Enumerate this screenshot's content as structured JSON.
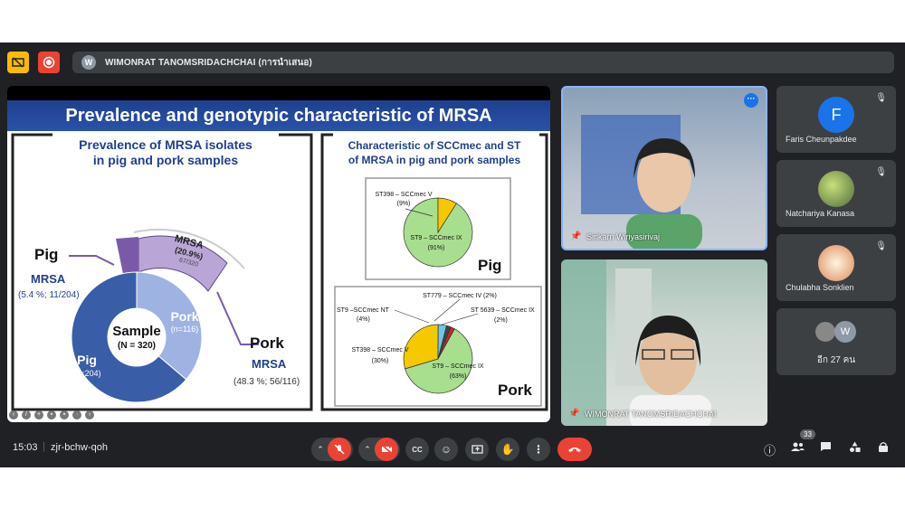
{
  "topbar": {
    "presenter_initial": "W",
    "presenter_name": "WIMONRAT TANOMSRIDACHCHAI (การนำเสนอ)"
  },
  "slide": {
    "title": "Prevalence and genotypic characteristic of MRSA",
    "left_panel": {
      "heading_line1": "Prevalence of MRSA isolates",
      "heading_line2": "in pig and pork samples",
      "pig_label": "Pig",
      "pig_mrsa": "MRSA",
      "pig_stat": "(5.4 %; 11/204)",
      "pork_label": "Pork",
      "pork_mrsa": "MRSA",
      "pork_stat": "(48.3 %; 56/116)",
      "mrsa_arc_label": "MRSA",
      "mrsa_arc_pct": "(20.9%)",
      "mrsa_arc_count": "67/320",
      "center_label": "Sample",
      "center_n": "(N = 320)",
      "pig_slice_label": "Pig",
      "pig_slice_n": "(n=204)",
      "pork_slice_label": "Pork",
      "pork_slice_n": "(n=116)"
    },
    "right_panel": {
      "heading_line1": "Characteristic of SCCmec and ST",
      "heading_line2": "of MRSA in pig and pork samples",
      "pig_chart_title": "Pig",
      "pig_st398": "ST398 – SCCmec V",
      "pig_st398_pct": "(9%)",
      "pig_st9": "ST9 – SCCmec IX",
      "pig_st9_pct": "(91%)",
      "pork_chart_title": "Pork",
      "pork_st779": "ST779 – SCCmec IV (2%)",
      "pork_st9nt": "ST9 –SCCmec NT",
      "pork_st9nt_pct": "(4%)",
      "pork_st5639": "ST 5639 – SCCmec IX",
      "pork_st5639_pct": "(2%)",
      "pork_st398": "ST398 – SCCmec V",
      "pork_st398_pct": "(30%)",
      "pork_st9": "ST9 – SCCmec IX",
      "pork_st9_pct": "(63%)"
    }
  },
  "chart_data": [
    {
      "type": "pie",
      "title": "Pig",
      "categories": [
        "ST9 – SCCmec IX",
        "ST398 – SCCmec V"
      ],
      "values": [
        91,
        9
      ]
    },
    {
      "type": "pie",
      "title": "Pork",
      "categories": [
        "ST9 – SCCmec IX",
        "ST398 – SCCmec V",
        "ST9 –SCCmec NT",
        "ST779 – SCCmec IV",
        "ST 5639 – SCCmec IX"
      ],
      "values": [
        63,
        30,
        4,
        2,
        2
      ]
    },
    {
      "type": "pie",
      "title": "Sample",
      "categories": [
        "Pig",
        "Pork"
      ],
      "values": [
        204,
        116
      ]
    }
  ],
  "tiles": {
    "sirikarn_name": "Sirikarn Wiriyasirivaj",
    "wimonrat_name": "WIMONRAT TANOMSRIDACHCHAI",
    "faris_initial": "F",
    "faris_name": "Faris Cheunpakdee",
    "natchariya_name": "Natchariya Kanasa",
    "chulabha_name": "Chulabha Sonklien",
    "others_initial": "W",
    "others_label": "อีก 27 คน"
  },
  "bottombar": {
    "time": "15:03",
    "meeting_code": "zjr-bchw-qoh",
    "participant_count": "33"
  },
  "colors": {
    "accent": "#1a73e8",
    "danger": "#ea4335",
    "pie_green": "#a8df8e",
    "pie_yellow": "#f5c800",
    "donut_dark": "#3a5da8",
    "donut_light": "#9fb3e3",
    "mrsa_purple": "#b9a6d6"
  }
}
